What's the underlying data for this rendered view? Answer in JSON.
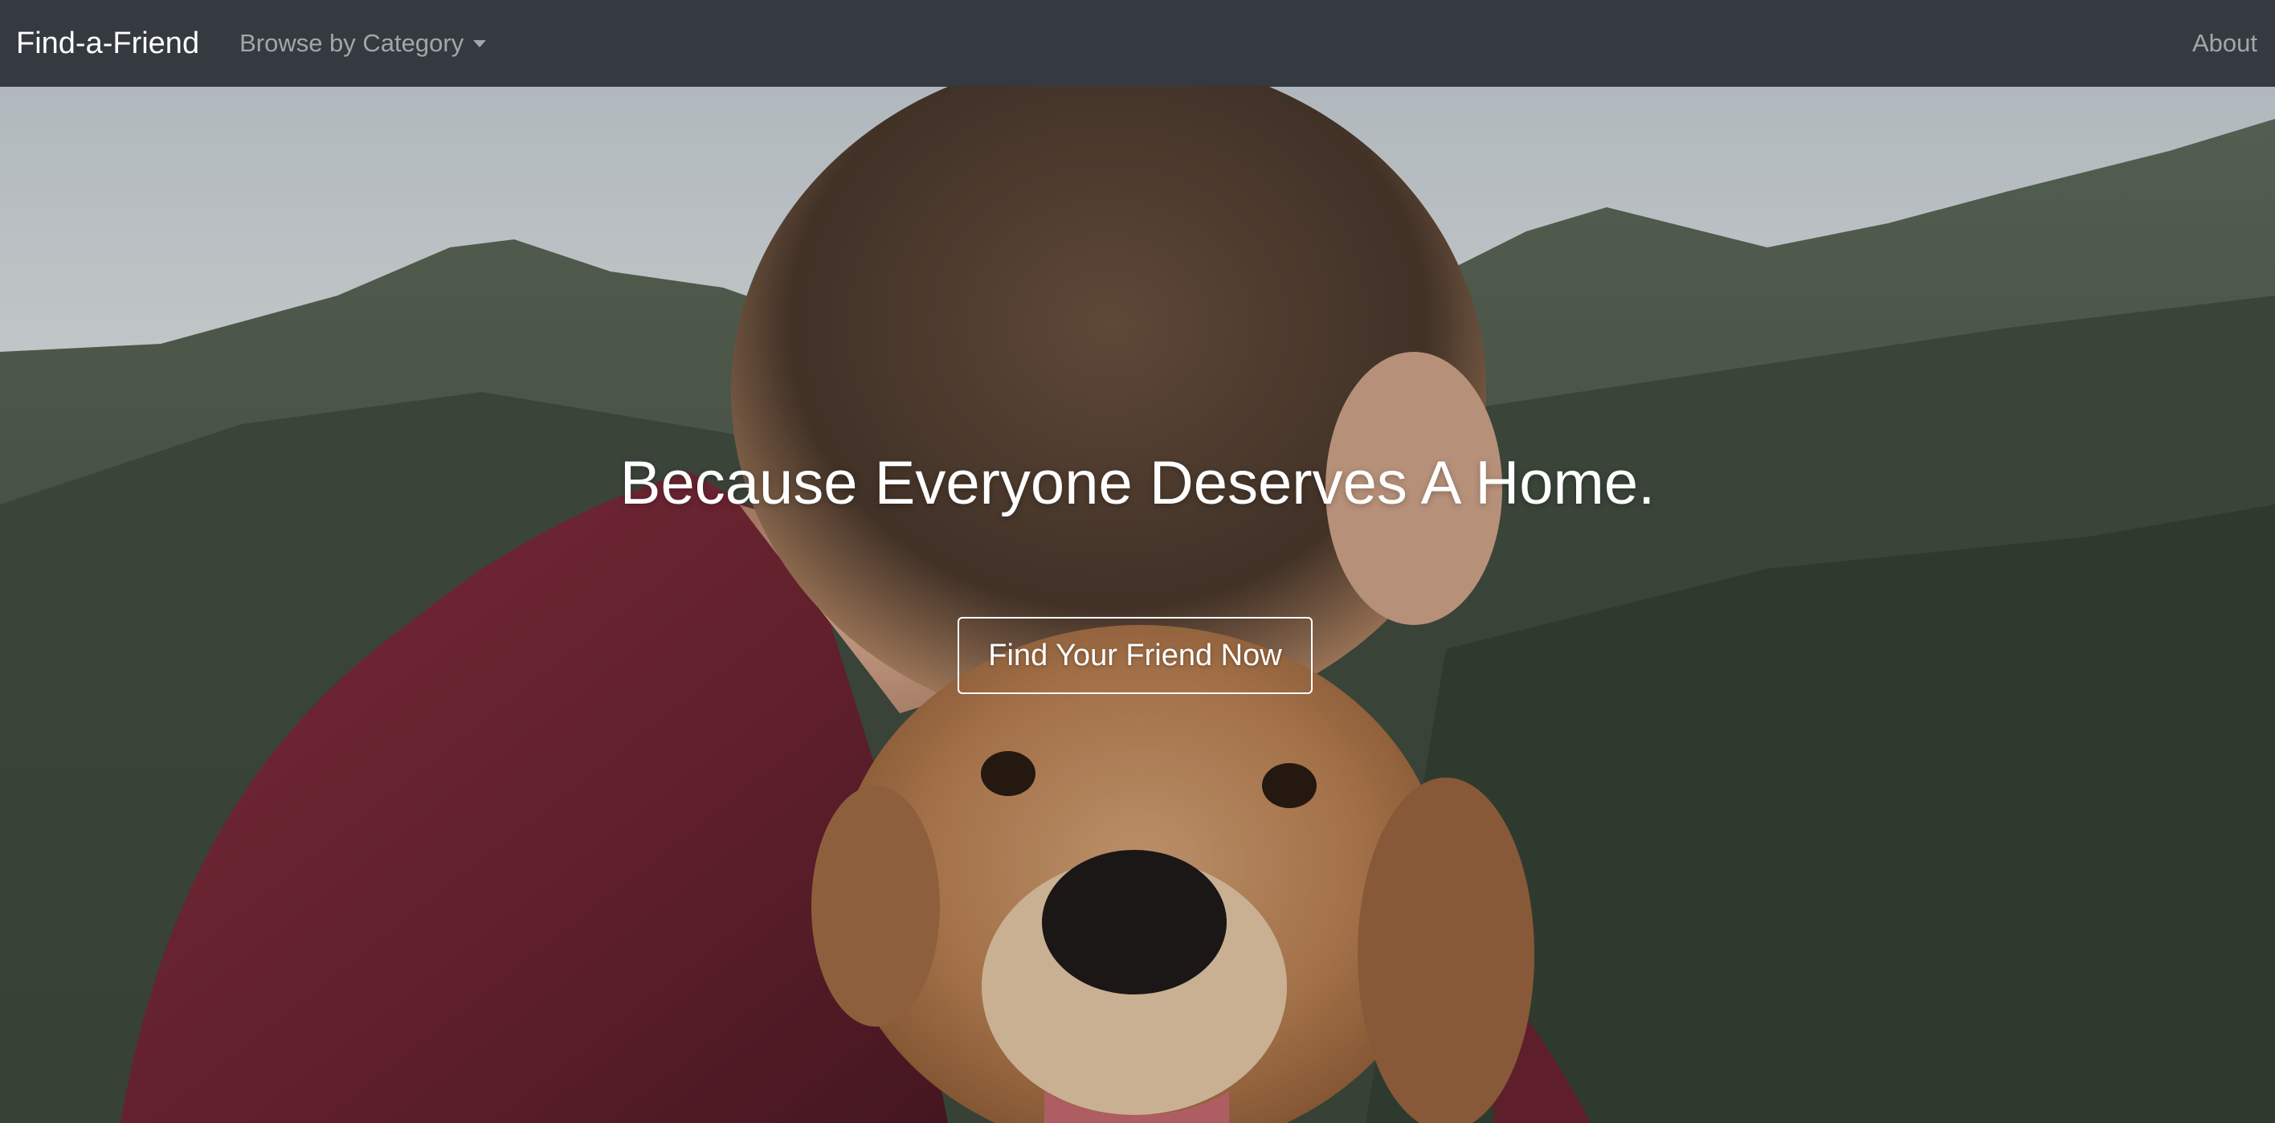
{
  "navbar": {
    "brand": "Find-a-Friend",
    "browse_label": "Browse by Category",
    "about_label": "About"
  },
  "hero": {
    "title": "Because Everyone Deserves A Home.",
    "cta_label": "Find Your Friend Now",
    "image_subject": "man hugging golden retriever in front of mountains"
  },
  "colors": {
    "navbar_bg": "#343a40",
    "nav_text_muted": "rgba(255,255,255,0.55)",
    "brand_text": "#ffffff"
  }
}
